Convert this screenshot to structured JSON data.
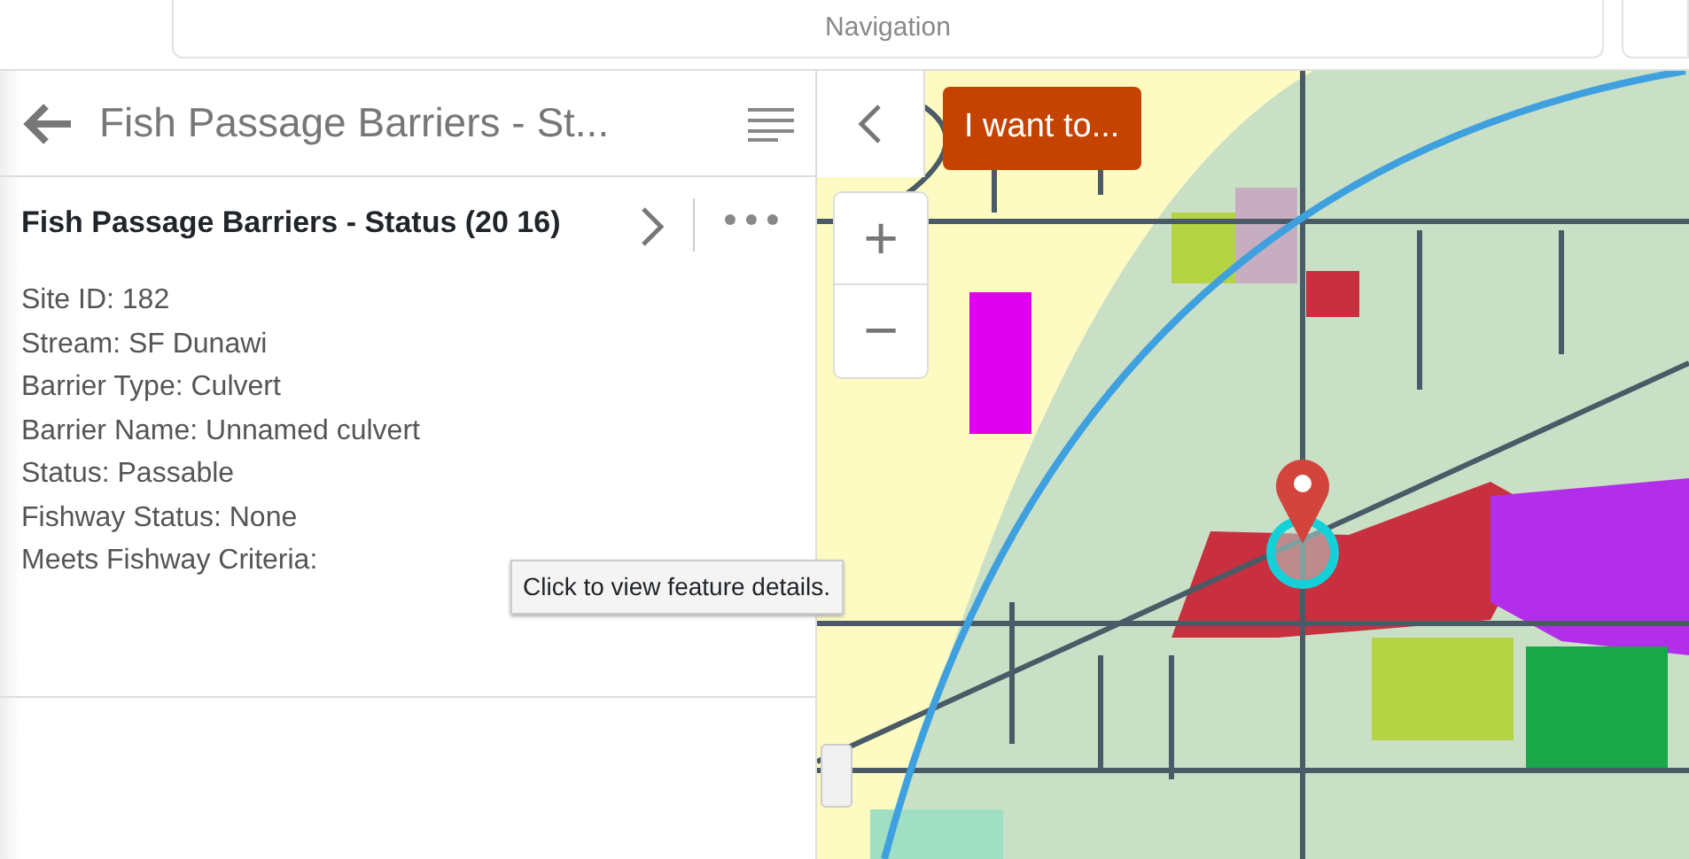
{
  "top_bar": {
    "title": "Navigation"
  },
  "panel": {
    "title": "Fish Passage Barriers - St...",
    "feature": {
      "title": "Fish Passage Barriers - Status (20 16)",
      "attributes": [
        "Site ID: 182",
        "Stream: SF Dunawi",
        "Barrier Type: Culvert",
        "Barrier Name: Unnamed culvert",
        "Status: Passable",
        "Fishway Status: None",
        "Meets Fishway Criteria:"
      ]
    }
  },
  "map": {
    "menu_button": "I want to...",
    "zoom_in": "+",
    "zoom_out": "−"
  },
  "tooltip": "Click to view feature details."
}
